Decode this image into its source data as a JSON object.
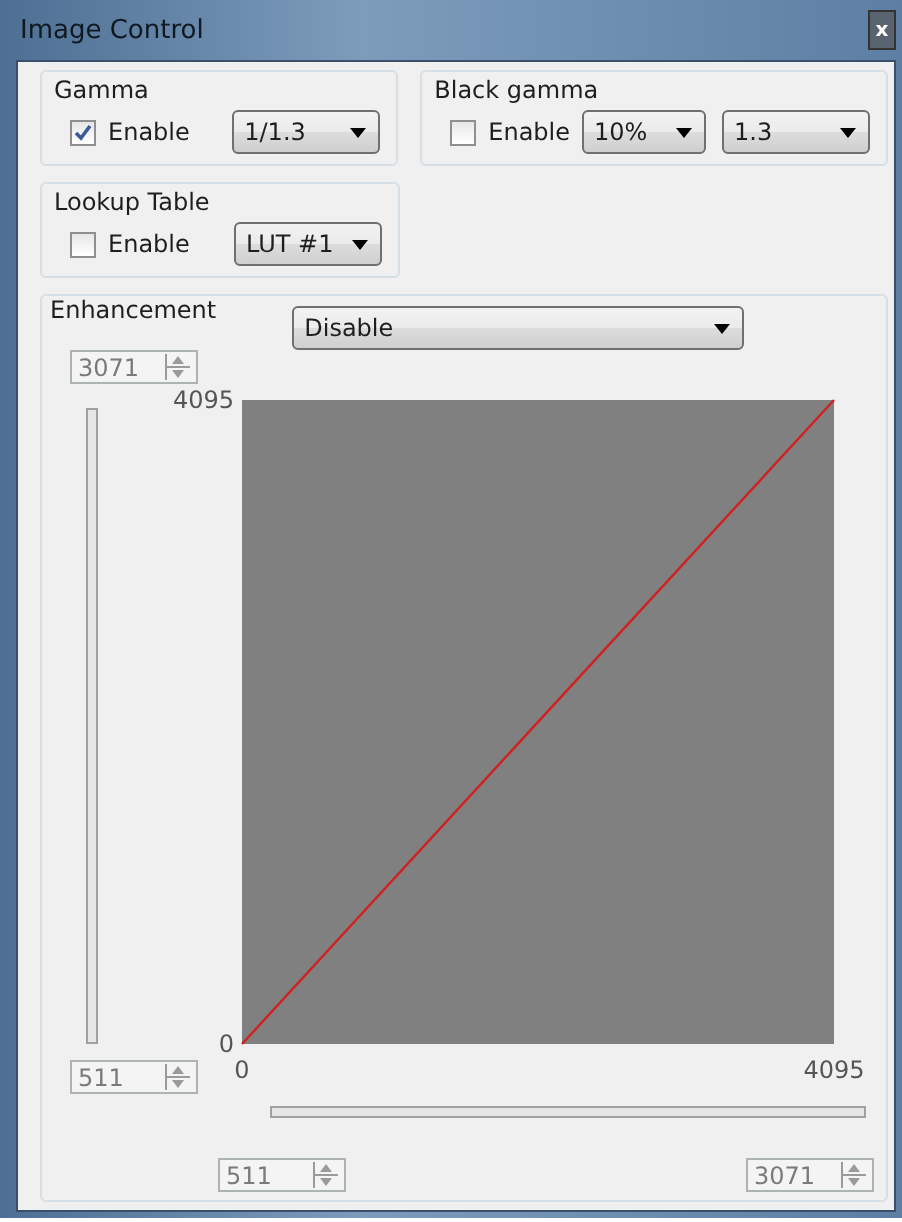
{
  "window": {
    "title": "Image Control",
    "close": "x"
  },
  "gamma": {
    "title": "Gamma",
    "enable": {
      "label": "Enable",
      "checked": true
    },
    "value": "1/1.3"
  },
  "black_gamma": {
    "title": "Black gamma",
    "enable": {
      "label": "Enable",
      "checked": false
    },
    "level": "10%",
    "value": "1.3"
  },
  "lookup_table": {
    "title": "Lookup Table",
    "enable": {
      "label": "Enable",
      "checked": false
    },
    "value": "LUT #1"
  },
  "enhancement": {
    "title": "Enhancement",
    "mode": "Disable",
    "y_max_spin": {
      "value": "3071",
      "disabled": true
    },
    "y_min_spin": {
      "value": "511",
      "disabled": true
    },
    "x_min_spin": {
      "value": "511",
      "disabled": true
    },
    "x_max_spin": {
      "value": "3071",
      "disabled": true
    },
    "chart_data": {
      "type": "line",
      "x": [
        0,
        4095
      ],
      "series": [
        {
          "color": "#d02020",
          "values": [
            0,
            4095
          ]
        }
      ],
      "xlim": [
        0,
        4095
      ],
      "ylim": [
        0,
        4095
      ],
      "xticks": [
        0,
        4095
      ],
      "yticks": [
        0,
        4095
      ]
    }
  }
}
